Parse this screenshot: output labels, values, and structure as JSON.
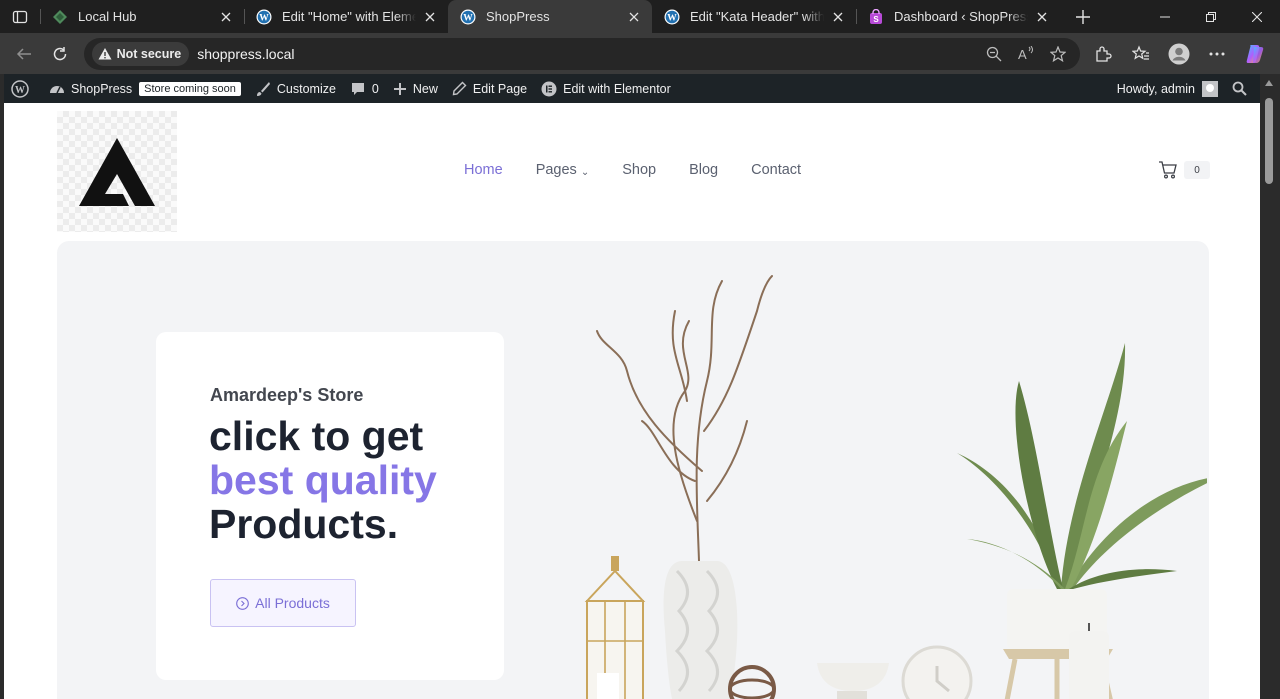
{
  "browser": {
    "tabs": [
      {
        "title": "Local Hub",
        "icon": "local-hub-icon",
        "active": false
      },
      {
        "title": "Edit \"Home\" with Elementor",
        "icon": "wordpress-icon",
        "active": false
      },
      {
        "title": "ShopPress",
        "icon": "wordpress-icon",
        "active": true
      },
      {
        "title": "Edit \"Kata Header\" with Elementor",
        "icon": "wordpress-icon",
        "active": false
      },
      {
        "title": "Dashboard ‹ ShopPress —",
        "icon": "shoppress-icon",
        "active": false
      }
    ],
    "security_label": "Not secure",
    "url": "shoppress.local"
  },
  "adminbar": {
    "site_name": "ShopPress",
    "coming_soon": "Store coming soon",
    "customize": "Customize",
    "comments_count": "0",
    "new_label": "New",
    "edit_page": "Edit Page",
    "edit_elementor": "Edit with Elementor",
    "howdy": "Howdy, admin"
  },
  "site": {
    "nav": [
      {
        "label": "Home",
        "active": true
      },
      {
        "label": "Pages",
        "has_dropdown": true
      },
      {
        "label": "Shop"
      },
      {
        "label": "Blog"
      },
      {
        "label": "Contact"
      }
    ],
    "cart_count": "0"
  },
  "hero": {
    "store_name": "Amardeep's Store",
    "headline_line1": "click to get",
    "headline_accent": "best quality",
    "headline_line3": "Products.",
    "cta_label": "All Products"
  },
  "colors": {
    "accent": "#8676e6",
    "admin_bar": "#1d2327",
    "hero_bg": "#f3f4f6"
  }
}
